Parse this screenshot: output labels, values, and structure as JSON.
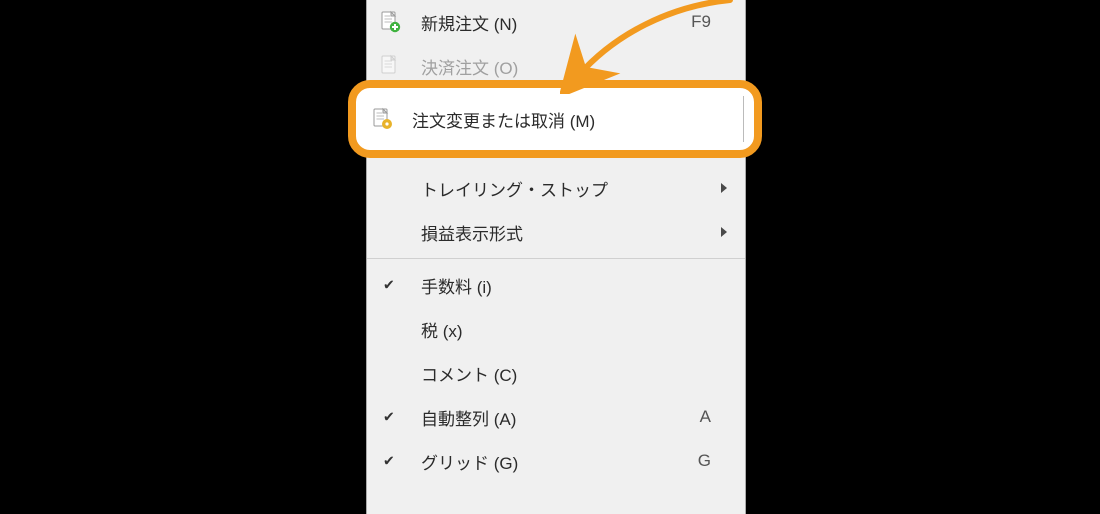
{
  "menu": {
    "items": [
      {
        "id": "new-order",
        "label": "新規注文 (N)",
        "shortcut": "F9",
        "icon": "doc-plus",
        "checked": false,
        "disabled": false,
        "submenu": false
      },
      {
        "id": "close-order",
        "label": "決済注文 (O)",
        "shortcut": "",
        "icon": "doc",
        "checked": false,
        "disabled": true,
        "submenu": false
      },
      {
        "id": "modify-order",
        "label": "注文変更または取消 (M)",
        "shortcut": "",
        "icon": "doc-gear",
        "checked": false,
        "disabled": false,
        "submenu": false,
        "highlighted": true
      },
      {
        "id": "trailing-stop",
        "label": "トレイリング・ストップ",
        "shortcut": "",
        "icon": "",
        "checked": false,
        "disabled": false,
        "submenu": true
      },
      {
        "id": "pl-format",
        "label": "損益表示形式",
        "shortcut": "",
        "icon": "",
        "checked": false,
        "disabled": false,
        "submenu": true
      },
      {
        "id": "sep1",
        "separator": true
      },
      {
        "id": "commission",
        "label": "手数料 (i)",
        "shortcut": "",
        "icon": "",
        "checked": true,
        "disabled": false,
        "submenu": false
      },
      {
        "id": "tax",
        "label": "税 (x)",
        "shortcut": "",
        "icon": "",
        "checked": false,
        "disabled": false,
        "submenu": false
      },
      {
        "id": "comment",
        "label": "コメント (C)",
        "shortcut": "",
        "icon": "",
        "checked": false,
        "disabled": false,
        "submenu": false
      },
      {
        "id": "auto-arrange",
        "label": "自動整列 (A)",
        "shortcut": "A",
        "icon": "",
        "checked": true,
        "disabled": false,
        "submenu": false
      },
      {
        "id": "grid",
        "label": "グリッド (G)",
        "shortcut": "G",
        "icon": "",
        "checked": true,
        "disabled": false,
        "submenu": false
      }
    ]
  },
  "annotation": {
    "arrow_color": "#f29a1f",
    "callout_color": "#f29a1f"
  }
}
